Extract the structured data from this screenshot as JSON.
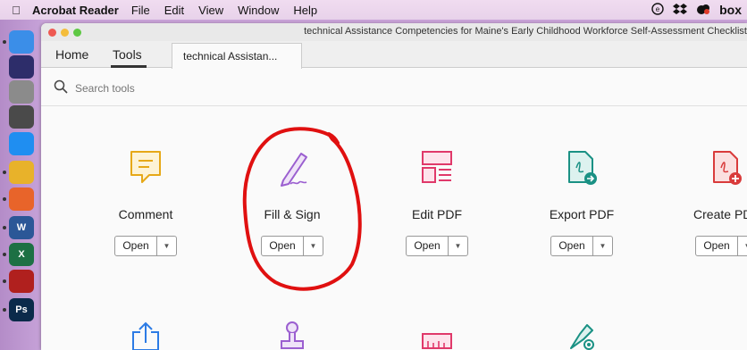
{
  "menubar": {
    "apple_icon": "apple-icon",
    "app_name": "Acrobat Reader",
    "items": [
      "File",
      "Edit",
      "View",
      "Window",
      "Help"
    ],
    "status_icons": [
      "creative-cloud-icon",
      "dropbox-icon",
      "creative-cloud-sync-icon",
      "box-icon"
    ],
    "box_label": "box"
  },
  "dock": {
    "apps": [
      {
        "name": "Finder",
        "icon": "finder-icon",
        "color": "#3b8ee8"
      },
      {
        "name": "Siri",
        "icon": "siri-icon",
        "color": "#2d2d6a"
      },
      {
        "name": "Launchpad",
        "icon": "launchpad-icon",
        "color": "#8b8b8b"
      },
      {
        "name": "Calculator",
        "icon": "calculator-icon",
        "color": "#4a4a4a"
      },
      {
        "name": "Safari",
        "icon": "safari-icon",
        "color": "#1f8ef1"
      },
      {
        "name": "Chrome",
        "icon": "chrome-icon",
        "color": "#e8b22a"
      },
      {
        "name": "Firefox",
        "icon": "firefox-icon",
        "color": "#e8642a"
      },
      {
        "name": "Word",
        "icon": "word-icon",
        "color": "#2b5797",
        "glyph": "W"
      },
      {
        "name": "Excel",
        "icon": "excel-icon",
        "color": "#1d7044",
        "glyph": "X"
      },
      {
        "name": "Acrobat",
        "icon": "acrobat-icon",
        "color": "#b0201e"
      },
      {
        "name": "Photoshop",
        "icon": "photoshop-icon",
        "color": "#0b2a4a",
        "glyph": "Ps"
      }
    ]
  },
  "window": {
    "title": "technical Assistance Competencies for Maine's Early Childhood Workforce Self-Assessment Checklist",
    "tabs": {
      "home": "Home",
      "tools": "Tools",
      "document": "technical Assistan..."
    },
    "search": {
      "placeholder": "Search tools"
    }
  },
  "tools": [
    {
      "label": "Comment",
      "icon": "comment-icon",
      "color": "#e6a817",
      "open": "Open"
    },
    {
      "label": "Fill & Sign",
      "icon": "fill-sign-icon",
      "color": "#9b5fd0",
      "open": "Open"
    },
    {
      "label": "Edit PDF",
      "icon": "edit-pdf-icon",
      "color": "#e0396a",
      "open": "Open"
    },
    {
      "label": "Export PDF",
      "icon": "export-pdf-icon",
      "color": "#1a9184",
      "open": "Open"
    },
    {
      "label": "Create PDF",
      "icon": "create-pdf-icon",
      "color": "#d93b3b",
      "open": "Open"
    }
  ],
  "second_row_icons": [
    {
      "icon": "share-icon",
      "color": "#2c7be5"
    },
    {
      "icon": "stamp-icon",
      "color": "#9b5fd0"
    },
    {
      "icon": "measure-icon",
      "color": "#e0396a"
    },
    {
      "icon": "certificates-icon",
      "color": "#1a9184"
    }
  ],
  "annotation": {
    "color": "#e01010",
    "target": "Fill & Sign"
  }
}
